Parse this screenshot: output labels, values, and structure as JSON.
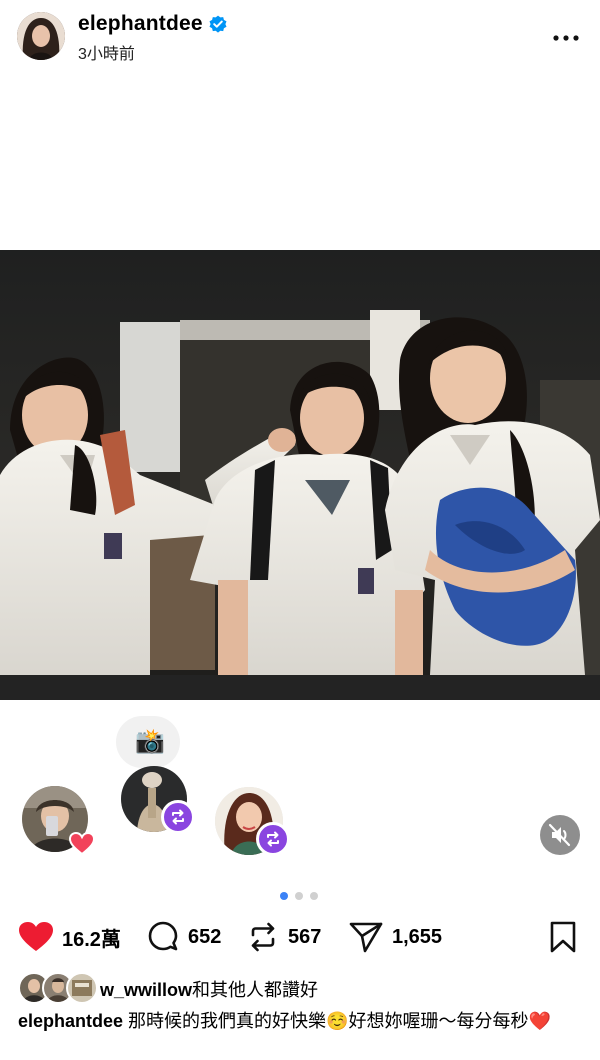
{
  "header": {
    "username": "elephantdee",
    "verified": true,
    "timestamp": "3小時前",
    "more_icon": "more-horizontal-icon"
  },
  "reactions": {
    "camera_emoji": "📸",
    "mute_icon": "muted-speaker-icon"
  },
  "carousel": {
    "count": 3,
    "active": 0
  },
  "actions": {
    "likes": "16.2萬",
    "comments": "652",
    "reposts": "567",
    "shares": "1,655"
  },
  "liked_by": {
    "user": "w_wwillow",
    "suffix": "和其他人都讚好"
  },
  "caption": {
    "author": "elephantdee",
    "text": "那時候的我們真的好快樂☺️好想妳喔珊～每分每秒❤️"
  },
  "colors": {
    "heart": "#ed1c32",
    "repost_badge": "#8a45e0",
    "verified": "#0095f6",
    "dot_active": "#3b82f6"
  }
}
